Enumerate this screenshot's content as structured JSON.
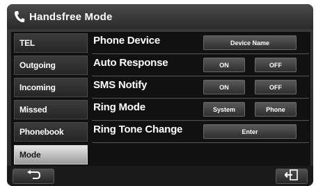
{
  "header": {
    "icon": "phone-icon",
    "title": "Handsfree Mode"
  },
  "sidebar": {
    "items": [
      {
        "label": "TEL",
        "selected": false
      },
      {
        "label": "Outgoing",
        "selected": false
      },
      {
        "label": "Incoming",
        "selected": false
      },
      {
        "label": "Missed",
        "selected": false
      },
      {
        "label": "Phonebook",
        "selected": false
      },
      {
        "label": "Mode",
        "selected": true
      }
    ]
  },
  "settings": {
    "phone_device": {
      "label": "Phone Device",
      "button": "Device Name"
    },
    "auto_response": {
      "label": "Auto Response",
      "on": "ON",
      "off": "OFF"
    },
    "sms_notify": {
      "label": "SMS Notify",
      "on": "ON",
      "off": "OFF"
    },
    "ring_mode": {
      "label": "Ring Mode",
      "system": "System",
      "phone": "Phone"
    },
    "ring_tone_change": {
      "label": "Ring Tone Change",
      "button": "Enter"
    }
  },
  "bottom_bar": {
    "back_icon": "back-arrow-icon",
    "exit_icon": "exit-icon"
  },
  "colors": {
    "background": "#2a2a2a",
    "selected_tab": "#d8d8d8",
    "text": "#ffffff"
  }
}
